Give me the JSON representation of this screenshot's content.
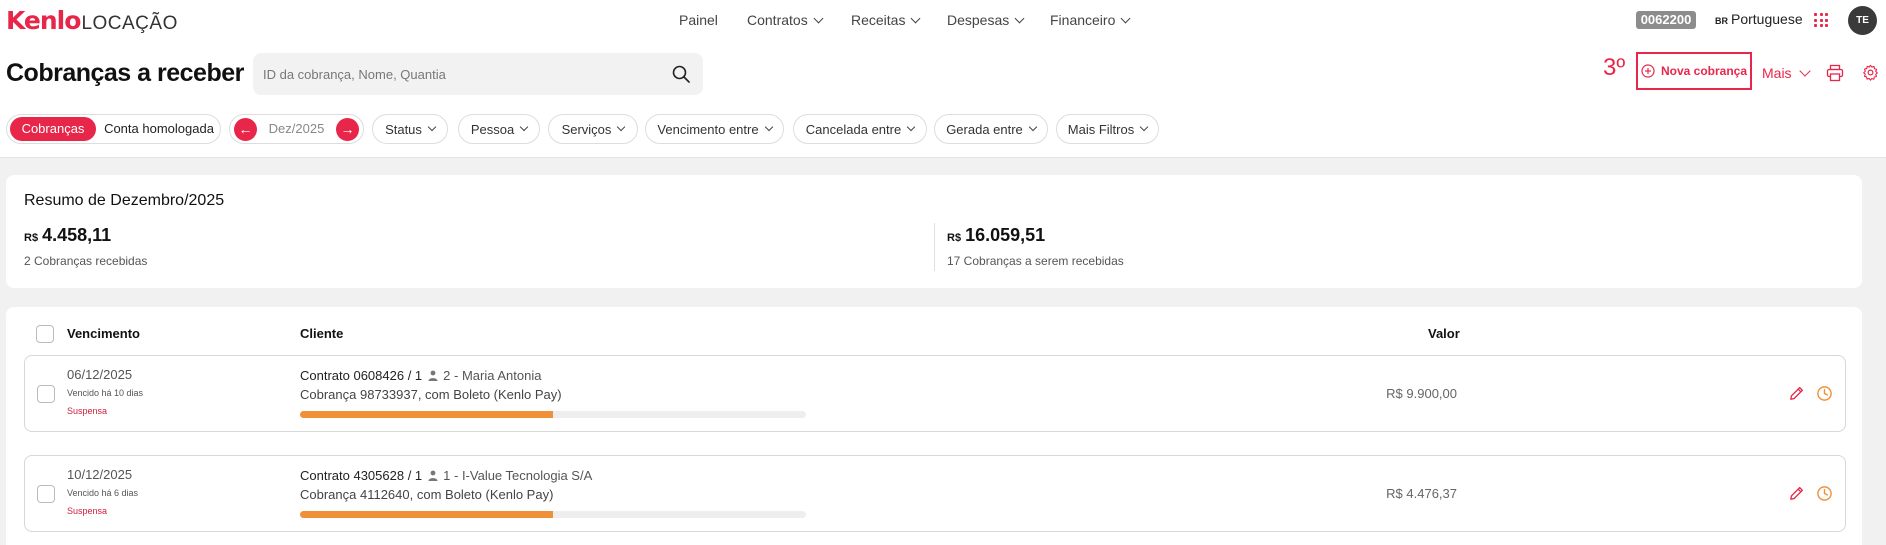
{
  "brand": {
    "logo_main": "Kenlo",
    "logo_sub": "LOCAÇÃO"
  },
  "nav": {
    "items": [
      {
        "label": "Painel",
        "dropdown": false
      },
      {
        "label": "Contratos",
        "dropdown": true
      },
      {
        "label": "Receitas",
        "dropdown": true
      },
      {
        "label": "Despesas",
        "dropdown": true
      },
      {
        "label": "Financeiro",
        "dropdown": true
      }
    ],
    "account_code": "0062200",
    "language_flag": "BR",
    "language": "Portuguese",
    "avatar_initials": "TE"
  },
  "header": {
    "title": "Cobranças a receber",
    "search_placeholder": "ID da cobrança, Nome, Quantia",
    "step_label": "3º",
    "new_button": "Nova cobrança",
    "more_button": "Mais"
  },
  "filters": {
    "toggle_active": "Cobranças",
    "toggle_inactive": "Conta homologada",
    "month": "Dez/2025",
    "month_prev": "←",
    "month_next": "→",
    "chips": [
      "Status",
      "Pessoa",
      "Serviços",
      "Vencimento entre",
      "Cancelada entre",
      "Gerada entre",
      "Mais Filtros"
    ]
  },
  "summary": {
    "title": "Resumo de Dezembro/2025",
    "currency": "R$",
    "received_amount": "4.458,11",
    "received_label": "2 Cobranças recebidas",
    "pending_amount": "16.059,51",
    "pending_label": "17 Cobranças a serem recebidas"
  },
  "table": {
    "columns": {
      "due": "Vencimento",
      "client": "Cliente",
      "value": "Valor"
    },
    "rows": [
      {
        "due_date": "06/12/2025",
        "overdue": "Vencido há 10 dias",
        "status": "Suspensa",
        "contract": "Contrato 0608426 / 1",
        "person": "2 - Maria Antonia",
        "charge": "Cobrança 98733937, com Boleto (Kenlo Pay)",
        "progress": 0.5,
        "value": "R$ 9.900,00"
      },
      {
        "due_date": "10/12/2025",
        "overdue": "Vencido há 6 dias",
        "status": "Suspensa",
        "contract": "Contrato 4305628 / 1",
        "person": "1 - I-Value Tecnologia S/A",
        "charge": "Cobrança 4112640, com Boleto (Kenlo Pay)",
        "progress": 0.5,
        "value": "R$ 4.476,37"
      }
    ]
  },
  "colors": {
    "brand": "#e8264a",
    "progress": "#f0913a",
    "status": "#d01e3c"
  }
}
